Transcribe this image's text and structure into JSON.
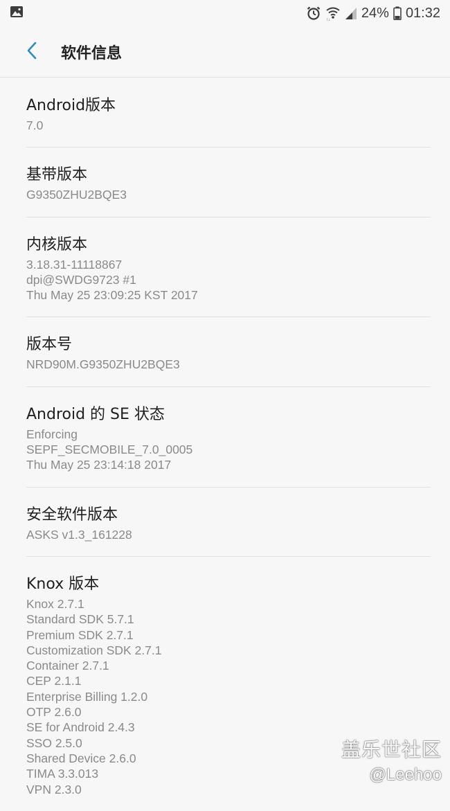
{
  "status_bar": {
    "battery": "24%",
    "time": "01:32",
    "icons": [
      "image-icon",
      "alarm-icon",
      "wifi-icon",
      "signal-icon",
      "battery-icon"
    ]
  },
  "header": {
    "title": "软件信息",
    "back_icon": "chevron-left-icon",
    "accent_color": "#2b8cbf"
  },
  "items": [
    {
      "title": "Android版本",
      "lines": [
        "7.0"
      ]
    },
    {
      "title": "基带版本",
      "lines": [
        "G9350ZHU2BQE3"
      ]
    },
    {
      "title": "内核版本",
      "lines": [
        "3.18.31-11118867",
        "dpi@SWDG9723 #1",
        "Thu May 25 23:09:25 KST 2017"
      ]
    },
    {
      "title": "版本号",
      "lines": [
        "NRD90M.G9350ZHU2BQE3"
      ]
    },
    {
      "title": "Android 的 SE 状态",
      "lines": [
        "Enforcing",
        "SEPF_SECMOBILE_7.0_0005",
        "Thu May 25 23:14:18 2017"
      ]
    },
    {
      "title": "安全软件版本",
      "lines": [
        "ASKS v1.3_161228"
      ]
    },
    {
      "title": "Knox 版本",
      "lines": [
        "Knox 2.7.1",
        "Standard SDK 5.7.1",
        "Premium SDK 2.7.1",
        "Customization SDK 2.7.1",
        "Container 2.7.1",
        "CEP 2.1.1",
        "Enterprise Billing 1.2.0",
        "OTP 2.6.0",
        "SE for Android 2.4.3",
        "SSO 2.5.0",
        "Shared Device 2.6.0",
        "TIMA 3.3.013",
        "VPN 2.3.0"
      ]
    }
  ],
  "watermark": {
    "line1": "盖乐世社区",
    "line2": "@Leehoo"
  }
}
